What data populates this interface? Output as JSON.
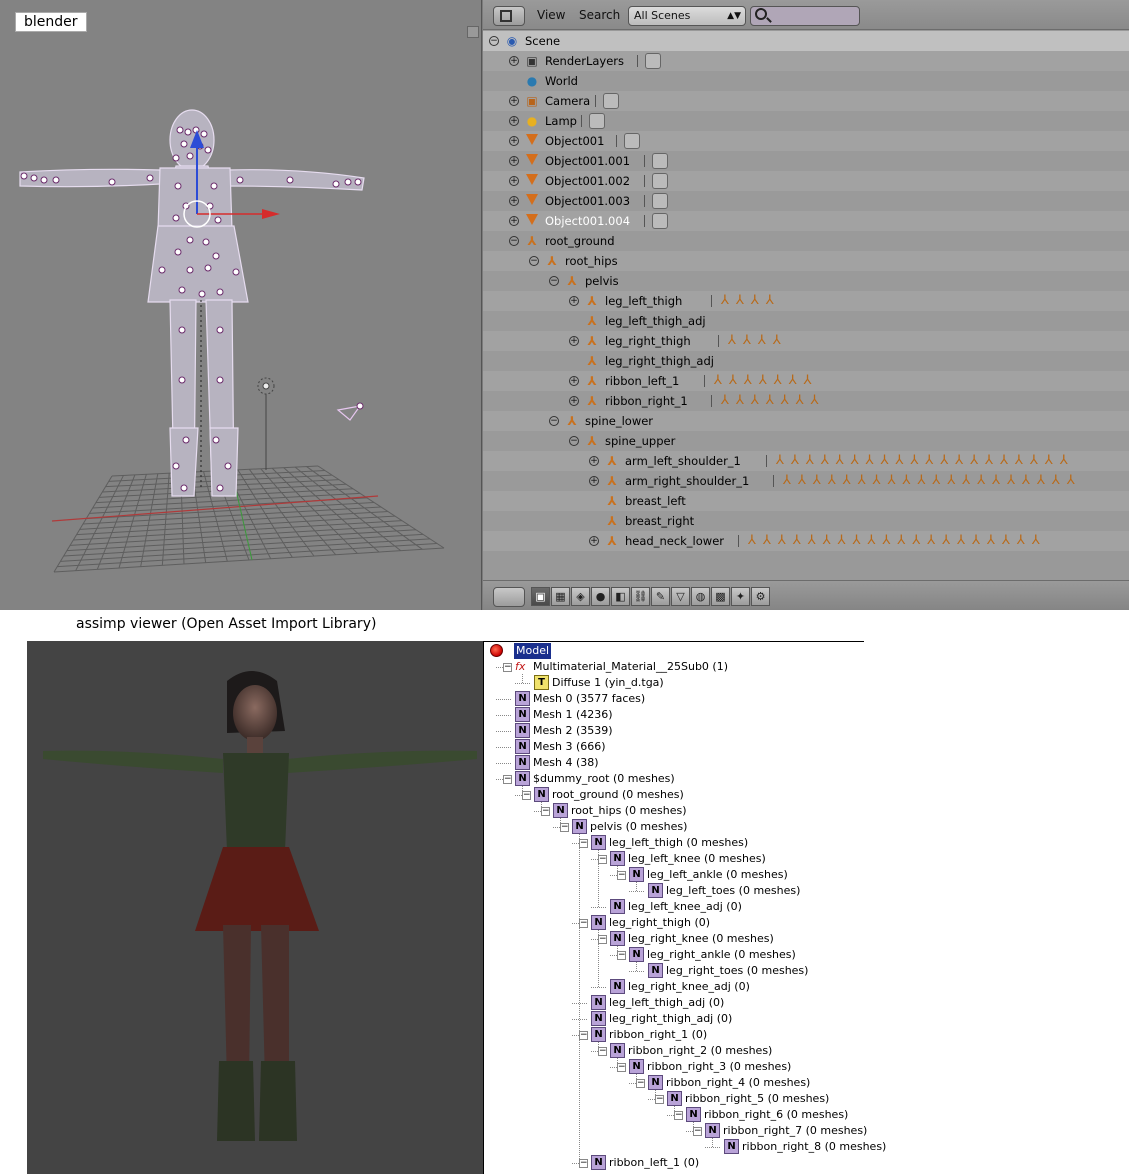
{
  "blender": {
    "label": "blender",
    "header": {
      "view_menu": "View",
      "search_menu": "Search",
      "scene_filter": "All Scenes"
    },
    "outliner": [
      {
        "label": "Scene",
        "depth": 0,
        "expanded": true,
        "icon": "scene-icon"
      },
      {
        "label": "RenderLayers",
        "depth": 1,
        "expanded": false,
        "icon": "renderlayers-icon",
        "extras": 1
      },
      {
        "label": "World",
        "depth": 1,
        "icon": "world-icon"
      },
      {
        "label": "Camera",
        "depth": 1,
        "expanded": false,
        "icon": "camera-icon",
        "extras": 1
      },
      {
        "label": "Lamp",
        "depth": 1,
        "expanded": false,
        "icon": "lamp-icon",
        "extras": 1
      },
      {
        "label": "Object001",
        "depth": 1,
        "expanded": false,
        "icon": "mesh-object-icon",
        "extras": 1
      },
      {
        "label": "Object001.001",
        "depth": 1,
        "expanded": false,
        "icon": "mesh-object-icon",
        "extras": 1
      },
      {
        "label": "Object001.002",
        "depth": 1,
        "expanded": false,
        "icon": "mesh-object-icon",
        "extras": 1
      },
      {
        "label": "Object001.003",
        "depth": 1,
        "expanded": false,
        "icon": "mesh-object-icon",
        "extras": 1
      },
      {
        "label": "Object001.004",
        "depth": 1,
        "expanded": false,
        "icon": "mesh-object-icon",
        "extras": 1,
        "highlight": true
      },
      {
        "label": "root_ground",
        "depth": 1,
        "expanded": true,
        "icon": "bone-icon"
      },
      {
        "label": "root_hips",
        "depth": 2,
        "expanded": true,
        "icon": "bone-icon"
      },
      {
        "label": "pelvis",
        "depth": 3,
        "expanded": true,
        "icon": "bone-icon"
      },
      {
        "label": "leg_left_thigh",
        "depth": 4,
        "expanded": false,
        "icon": "bone-icon",
        "children": 4
      },
      {
        "label": "leg_left_thigh_adj",
        "depth": 4,
        "icon": "bone-icon"
      },
      {
        "label": "leg_right_thigh",
        "depth": 4,
        "expanded": false,
        "icon": "bone-icon",
        "children": 4
      },
      {
        "label": "leg_right_thigh_adj",
        "depth": 4,
        "icon": "bone-icon"
      },
      {
        "label": "ribbon_left_1",
        "depth": 4,
        "expanded": false,
        "icon": "bone-icon",
        "children": 7
      },
      {
        "label": "ribbon_right_1",
        "depth": 4,
        "expanded": false,
        "icon": "bone-icon",
        "children": 7
      },
      {
        "label": "spine_lower",
        "depth": 3,
        "expanded": true,
        "icon": "bone-icon"
      },
      {
        "label": "spine_upper",
        "depth": 4,
        "expanded": true,
        "icon": "bone-icon"
      },
      {
        "label": "arm_left_shoulder_1",
        "depth": 5,
        "expanded": false,
        "icon": "bone-icon",
        "children": 20
      },
      {
        "label": "arm_right_shoulder_1",
        "depth": 5,
        "expanded": false,
        "icon": "bone-icon",
        "children": 20
      },
      {
        "label": "breast_left",
        "depth": 5,
        "icon": "bone-icon"
      },
      {
        "label": "breast_right",
        "depth": 5,
        "icon": "bone-icon"
      },
      {
        "label": "head_neck_lower",
        "depth": 5,
        "expanded": false,
        "icon": "bone-icon",
        "children": 20
      }
    ]
  },
  "assimp": {
    "label": "assimp viewer (Open Asset Import Library)",
    "tree": [
      {
        "label": "Model",
        "depth": 0,
        "icon": "model-icon",
        "selected": true
      },
      {
        "label": "Multimaterial_Material__25Sub0 (1)",
        "depth": 1,
        "icon": "material-icon",
        "toggle": "-"
      },
      {
        "label": "Diffuse 1 (yin_d.tga)",
        "depth": 2,
        "icon": "texture-icon"
      },
      {
        "label": "Mesh 0 (3577 faces)",
        "depth": 1,
        "icon": "node-icon"
      },
      {
        "label": "Mesh 1 (4236)",
        "depth": 1,
        "icon": "node-icon"
      },
      {
        "label": "Mesh 2 (3539)",
        "depth": 1,
        "icon": "node-icon"
      },
      {
        "label": "Mesh 3 (666)",
        "depth": 1,
        "icon": "node-icon"
      },
      {
        "label": "Mesh 4 (38)",
        "depth": 1,
        "icon": "node-icon"
      },
      {
        "label": "$dummy_root (0 meshes)",
        "depth": 1,
        "icon": "node-icon",
        "toggle": "-"
      },
      {
        "label": "root_ground (0 meshes)",
        "depth": 2,
        "icon": "node-icon",
        "toggle": "-"
      },
      {
        "label": "root_hips (0 meshes)",
        "depth": 3,
        "icon": "node-icon",
        "toggle": "-"
      },
      {
        "label": "pelvis (0 meshes)",
        "depth": 4,
        "icon": "node-icon",
        "toggle": "-"
      },
      {
        "label": "leg_left_thigh (0 meshes)",
        "depth": 5,
        "icon": "node-icon",
        "toggle": "-"
      },
      {
        "label": "leg_left_knee (0 meshes)",
        "depth": 6,
        "icon": "node-icon",
        "toggle": "-"
      },
      {
        "label": "leg_left_ankle (0 meshes)",
        "depth": 7,
        "icon": "node-icon",
        "toggle": "-"
      },
      {
        "label": "leg_left_toes (0 meshes)",
        "depth": 8,
        "icon": "node-icon"
      },
      {
        "label": "leg_left_knee_adj (0)",
        "depth": 6,
        "icon": "node-icon"
      },
      {
        "label": "leg_right_thigh (0)",
        "depth": 5,
        "icon": "node-icon",
        "toggle": "-"
      },
      {
        "label": "leg_right_knee (0 meshes)",
        "depth": 6,
        "icon": "node-icon",
        "toggle": "-"
      },
      {
        "label": "leg_right_ankle (0 meshes)",
        "depth": 7,
        "icon": "node-icon",
        "toggle": "-"
      },
      {
        "label": "leg_right_toes (0 meshes)",
        "depth": 8,
        "icon": "node-icon"
      },
      {
        "label": "leg_right_knee_adj (0)",
        "depth": 6,
        "icon": "node-icon"
      },
      {
        "label": "leg_left_thigh_adj (0)",
        "depth": 5,
        "icon": "node-icon"
      },
      {
        "label": "leg_right_thigh_adj (0)",
        "depth": 5,
        "icon": "node-icon"
      },
      {
        "label": "ribbon_right_1 (0)",
        "depth": 5,
        "icon": "node-icon",
        "toggle": "-"
      },
      {
        "label": "ribbon_right_2 (0 meshes)",
        "depth": 6,
        "icon": "node-icon",
        "toggle": "-"
      },
      {
        "label": "ribbon_right_3 (0 meshes)",
        "depth": 7,
        "icon": "node-icon",
        "toggle": "-"
      },
      {
        "label": "ribbon_right_4 (0 meshes)",
        "depth": 8,
        "icon": "node-icon",
        "toggle": "-"
      },
      {
        "label": "ribbon_right_5 (0 meshes)",
        "depth": 9,
        "icon": "node-icon",
        "toggle": "-"
      },
      {
        "label": "ribbon_right_6 (0 meshes)",
        "depth": 10,
        "icon": "node-icon",
        "toggle": "-"
      },
      {
        "label": "ribbon_right_7 (0 meshes)",
        "depth": 11,
        "icon": "node-icon",
        "toggle": "-"
      },
      {
        "label": "ribbon_right_8 (0 meshes)",
        "depth": 12,
        "icon": "node-icon"
      },
      {
        "label": "ribbon_left_1 (0)",
        "depth": 5,
        "icon": "node-icon",
        "toggle": "-"
      }
    ]
  },
  "colors": {
    "blender_bg": "#838383",
    "outliner_bg": "#999999",
    "bone_orange": "#c9711e",
    "mesh_orange": "#d46e1b",
    "node_purple": "#b9a3d8",
    "selection_blue": "#1a2f8d",
    "assimp_viewport": "#444444"
  }
}
